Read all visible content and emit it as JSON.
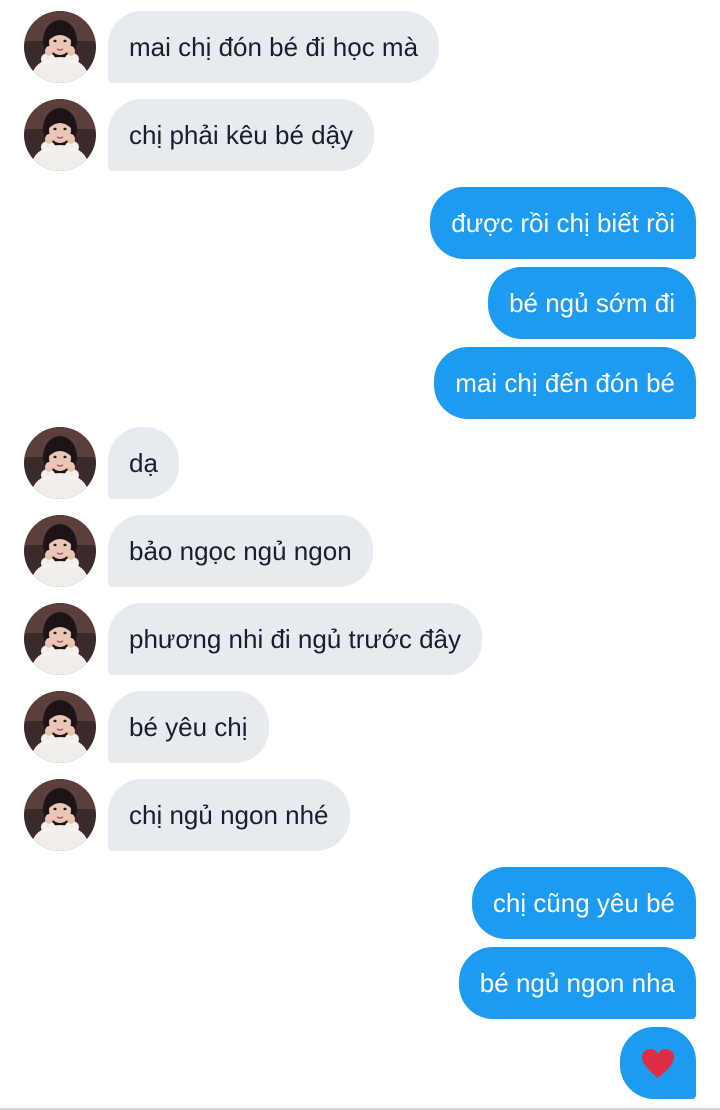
{
  "conversation": {
    "messages": [
      {
        "from": "them",
        "text": "mai chị đón bé đi học mà"
      },
      {
        "from": "them",
        "text": "chị phải kêu bé dậy"
      },
      {
        "from": "me",
        "text": "được rồi chị biết rồi"
      },
      {
        "from": "me",
        "text": "bé ngủ sớm đi"
      },
      {
        "from": "me",
        "text": "mai chị đến đón bé"
      },
      {
        "from": "them",
        "text": "dạ"
      },
      {
        "from": "them",
        "text": "bảo ngọc ngủ ngon"
      },
      {
        "from": "them",
        "text": "phương nhi đi ngủ trước đây"
      },
      {
        "from": "them",
        "text": "bé yêu chị"
      },
      {
        "from": "them",
        "text": "chị ngủ ngon nhé"
      },
      {
        "from": "me",
        "text": "chị cũng yêu bé"
      },
      {
        "from": "me",
        "text": "bé ngủ ngon nha"
      },
      {
        "from": "me",
        "text": "❤️",
        "icon": "heart-emoji"
      }
    ]
  },
  "colors": {
    "incoming_bubble": "#e7ebef",
    "outgoing_bubble": "#1d9bf0",
    "incoming_text": "#15202b",
    "outgoing_text": "#ffffff"
  }
}
